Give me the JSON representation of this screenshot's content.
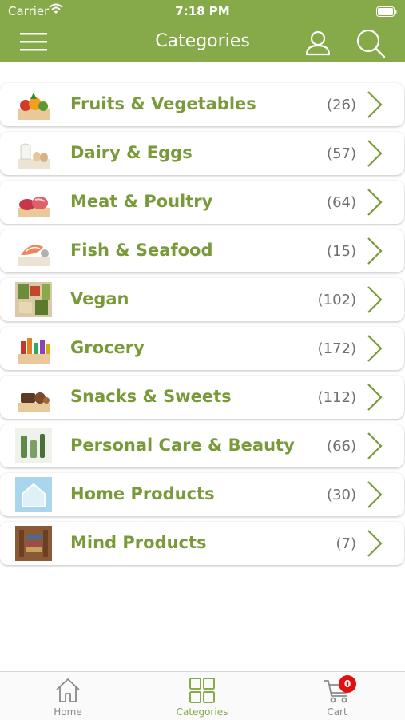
{
  "status_bar": {
    "carrier": "Carrier",
    "time": "7:18 PM"
  },
  "header": {
    "title": "Categories",
    "icons": [
      "menu-icon",
      "user-icon",
      "search-icon"
    ]
  },
  "colors": {
    "brand": "#86a94a",
    "label": "#7a9a3a",
    "badge": "#e01010"
  },
  "categories": [
    {
      "label": "Fruits & Vegetables",
      "count": "(26)"
    },
    {
      "label": "Dairy & Eggs",
      "count": "(57)"
    },
    {
      "label": "Meat & Poultry",
      "count": "(64)"
    },
    {
      "label": "Fish & Seafood",
      "count": "(15)"
    },
    {
      "label": "Vegan",
      "count": "(102)"
    },
    {
      "label": "Grocery",
      "count": "(172)"
    },
    {
      "label": "Snacks & Sweets",
      "count": "(112)"
    },
    {
      "label": "Personal Care & Beauty",
      "count": "(66)"
    },
    {
      "label": "Home Products",
      "count": "(30)"
    },
    {
      "label": "Mind Products",
      "count": "(7)"
    }
  ],
  "tabbar": {
    "home": "Home",
    "categories": "Categories",
    "cart": "Cart",
    "cart_badge": "0",
    "active": "categories"
  }
}
